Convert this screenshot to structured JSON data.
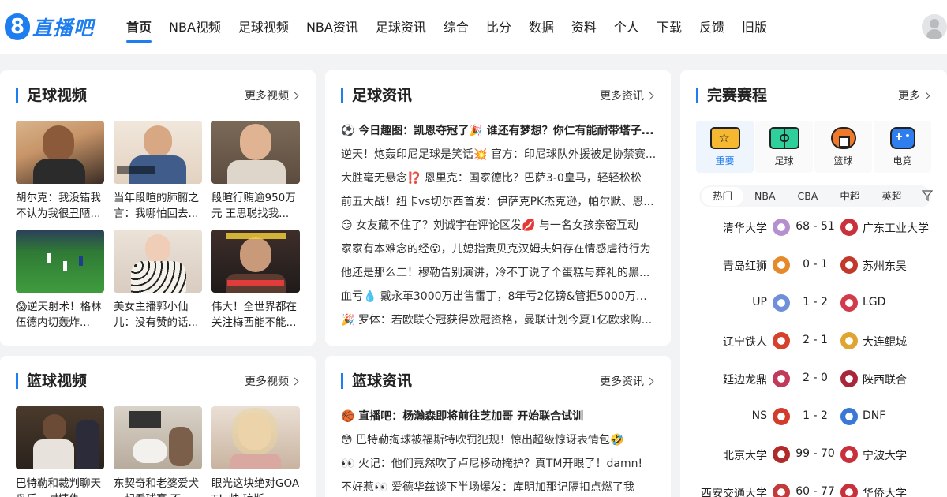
{
  "header": {
    "logo_digit": "8",
    "logo_text": "直播吧",
    "nav": [
      "首页",
      "NBA视频",
      "足球视频",
      "NBA资讯",
      "足球资讯",
      "综合",
      "比分",
      "数据",
      "资料",
      "个人",
      "下载",
      "反馈",
      "旧版"
    ]
  },
  "football_video": {
    "title": "足球视频",
    "more": "更多视频",
    "items": [
      {
        "caption": "胡尔克：我没错我不认为我很丑陋..."
      },
      {
        "caption": "当年段暄的肺腑之言：我哪怕回去..."
      },
      {
        "caption": "段暄行贿逾950万元 王思聪找我..."
      },
      {
        "caption": "😱逆天射术！格林伍德内切轰炸..."
      },
      {
        "caption": "美女主播郭小仙儿：没有赞的话..."
      },
      {
        "caption": "伟大！全世界都在关注梅西能不能..."
      }
    ]
  },
  "football_news": {
    "title": "足球资讯",
    "more": "更多资讯",
    "items": [
      "⚽ 今日趣图：凯恩夺冠了🎉 谁还有梦想？你仁有能耐带塔子...",
      "逆天！炮轰印尼足球是笑话💥 官方：印尼球队外援被足协禁赛...",
      "大胜毫无悬念⁉️ 恩里克：国家德比？巴萨3-0皇马，轻轻松松",
      "前五大战！纽卡vs切尔西首发：伊萨克PK杰克逊，帕尔默、恩...",
      "😏 女友藏不住了？刘诚宇在评论区发💋 与一名女孩亲密互动",
      "家家有本难念的经😮，儿媳指责贝克汉姆夫妇存在情感虐待行为",
      "他还是那么二！穆勒告别演讲，冷不丁说了个蛋糕与葬礼的黑...",
      "血亏💧 戴永革3000万出售雷丁，8年亏2亿镑&管拒5000万报...",
      "🎉 罗体：若欧联夺冠获得欧冠资格，曼联计划今夏1亿欧求购..."
    ]
  },
  "basketball_video": {
    "title": "篮球视频",
    "more": "更多视频",
    "items": [
      {
        "caption": "巴特勒和裁判聊天鸟乐，对情仇..."
      },
      {
        "caption": "东契奇和老婆爱犬一起看球赛 不..."
      },
      {
        "caption": "眼光这块绝对GOAT！帅 琼斯..."
      }
    ]
  },
  "basketball_news": {
    "title": "篮球资讯",
    "more": "更多资讯",
    "items": [
      "🏀 直播吧：杨瀚森即将前往芝加哥 开始联合试训",
      "😳 巴特勒掏球被福斯特吹罚犯规！惊出超级惊讶表情包🤣",
      "👀 火记：他们竟然吹了卢尼移动掩护？真TM开眼了！damn!",
      "不好惹👀 爱德华兹谈下半场爆发：库明加那记隔扣点燃了我"
    ]
  },
  "schedule": {
    "title": "完赛赛程",
    "more": "更多",
    "categories": [
      "重要",
      "足球",
      "篮球",
      "电竞"
    ],
    "league_tabs": [
      "热门",
      "NBA",
      "CBA",
      "中超",
      "英超"
    ],
    "matches": [
      {
        "home": "清华大学",
        "score": "68 - 51",
        "away": "广东工业大学",
        "home_color": "#b68fcf",
        "away_color": "#c9313b"
      },
      {
        "home": "青岛红狮",
        "score": "0 - 1",
        "away": "苏州东吴",
        "home_color": "#e6892a",
        "away_color": "#c0392b"
      },
      {
        "home": "UP",
        "score": "1 - 2",
        "away": "LGD",
        "home_color": "#6f8fd8",
        "away_color": "#d23b4b"
      },
      {
        "home": "辽宁铁人",
        "score": "2 - 1",
        "away": "大连鲲城",
        "home_color": "#d5412c",
        "away_color": "#e0a431"
      },
      {
        "home": "延边龙鼎",
        "score": "2 - 0",
        "away": "陕西联合",
        "home_color": "#c23a5b",
        "away_color": "#a8263a"
      },
      {
        "home": "NS",
        "score": "1 - 2",
        "away": "DNF",
        "home_color": "#d23c2a",
        "away_color": "#3a78d8"
      },
      {
        "home": "北京大学",
        "score": "99 - 70",
        "away": "宁波大学",
        "home_color": "#b12a2a",
        "away_color": "#c8313b"
      },
      {
        "home": "西安交通大学",
        "score": "60 - 77",
        "away": "华侨大学",
        "home_color": "#c23a3a",
        "away_color": "#c8313b"
      }
    ]
  },
  "colors": {
    "accent": "#1e7ef0",
    "background": "#f2f3f5"
  }
}
